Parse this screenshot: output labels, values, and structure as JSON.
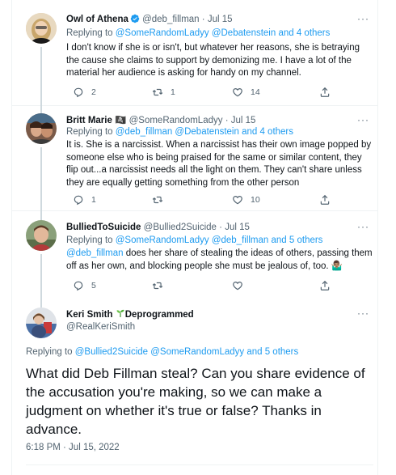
{
  "replies": [
    {
      "name": "Owl of Athena",
      "handle": "@deb_fillman",
      "date": "Jul 15",
      "replying_prefix": "Replying to",
      "replying_links": "@SomeRandomLadyy @Debatenstein and 4 others",
      "text": "I don't know if she is or isn't, but whatever her reasons, she is betraying the cause she claims to support by demonizing me. I have a lot of the material her audience is asking for handy on my channel.",
      "replies_count": "2",
      "retweets_count": "1",
      "likes_count": "14",
      "verified": true
    },
    {
      "name": "Britt Marie",
      "name_badge": "🏴‍☠️",
      "handle": "@SomeRandomLadyy",
      "date": "Jul 15",
      "replying_prefix": "Replying to",
      "replying_links": "@deb_fillman @Debatenstein and 4 others",
      "text": "It is. She is a narcissist. When a narcissist has their own image popped by someone else who is being praised for the same or similar content, they flip out...a narcissist needs all the light on them. They can't share unless they are equally getting something from the other person",
      "replies_count": "1",
      "retweets_count": "",
      "likes_count": "10"
    },
    {
      "name": "BulliedToSuicide",
      "handle": "@Bullied2Suicide",
      "date": "Jul 15",
      "replying_prefix": "Replying to",
      "replying_links": "@SomeRandomLadyy @deb_fillman and 5 others",
      "text_link": "@deb_fillman",
      "text": " does her share of stealing the ideas of others, passing them off as her own, and blocking people she must be jealous of, too. 🤷🏽‍♂️",
      "replies_count": "5",
      "retweets_count": "",
      "likes_count": ""
    }
  ],
  "main_tweet": {
    "name": "Keri Smith",
    "name_suffix": "Deprogrammed",
    "handle": "@RealKeriSmith",
    "replying_prefix": "Replying to",
    "replying_links": "@Bullied2Suicide @SomeRandomLadyy and 5 others",
    "text": "What did Deb Fillman steal? Can you share evidence of the accusation you're making, so we can make a judgment on whether it's true or false? Thanks in advance.",
    "timestamp": "6:18 PM · Jul 15, 2022"
  },
  "dot": "·",
  "more_icon": "···",
  "colors": {
    "link": "#1d9bf0",
    "muted": "#536471",
    "text": "#0f1419",
    "divider": "#eff3f4"
  }
}
